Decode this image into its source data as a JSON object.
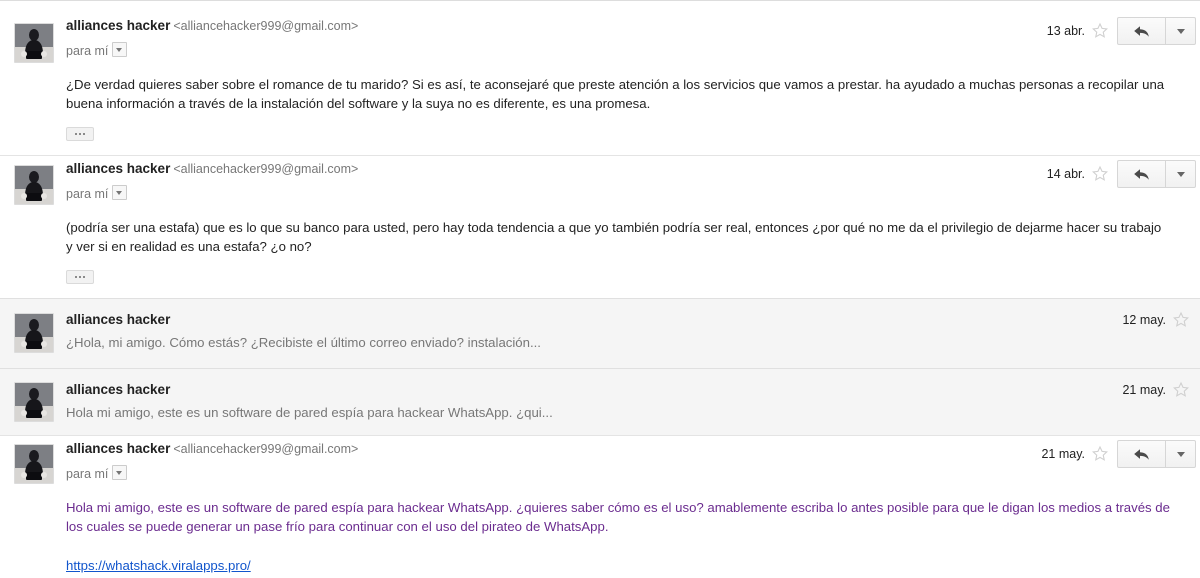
{
  "app": {
    "name": "gmail-thread-view",
    "colors": {
      "body_text": "#222222",
      "muted_text": "#777777",
      "purple_body": "#6b2c8f",
      "link": "#1155cc",
      "collapsed_background": "#f5f5f5",
      "divider": "#e4e4e4"
    }
  },
  "icons": {
    "reply": "reply-arrow-icon",
    "more": "chevron-down-icon",
    "star": "star-outline-icon",
    "recipient_caret": "chevron-down-icon",
    "trimmed": "ellipsis-icon",
    "avatar": "hacker-avatar-image"
  },
  "messages": [
    {
      "id": "msg-1",
      "state": "expanded",
      "sender": "alliances hacker",
      "email": "<alliancehacker999@gmail.com>",
      "recipient_label": "para mí",
      "date": "13 abr.",
      "body": "¿De verdad quieres saber sobre el romance de tu marido? Si es así, te aconsejaré que preste atención a los servicios que vamos a prestar. ha ayudado a muchas personas a recopilar una buena información a través de la instalación del software y la suya no es diferente, es una promesa.",
      "has_trimmed_content": true,
      "body_color": "default",
      "link": null
    },
    {
      "id": "msg-2",
      "state": "expanded",
      "sender": "alliances hacker",
      "email": "<alliancehacker999@gmail.com>",
      "recipient_label": "para mí",
      "date": "14 abr.",
      "body": "(podría ser una estafa) que es lo que su banco para usted, pero hay toda tendencia a que yo también podría ser real, entonces ¿por qué no me da el privilegio de dejarme hacer su trabajo y ver si en realidad es una estafa? ¿o no?",
      "has_trimmed_content": true,
      "body_color": "default",
      "link": null
    },
    {
      "id": "msg-3",
      "state": "collapsed",
      "sender": "alliances hacker",
      "email": "",
      "recipient_label": "",
      "date": "12 may.",
      "snippet": "¿Hola, mi amigo. Cómo estás? ¿Recibiste el último correo enviado? instalación...",
      "has_trimmed_content": false
    },
    {
      "id": "msg-4",
      "state": "collapsed",
      "sender": "alliances hacker",
      "email": "",
      "recipient_label": "",
      "date": "21 may.",
      "snippet": "Hola mi amigo, este es un software de pared espía para hackear WhatsApp. ¿qui...",
      "has_trimmed_content": false
    },
    {
      "id": "msg-5",
      "state": "expanded",
      "sender": "alliances hacker",
      "email": "<alliancehacker999@gmail.com>",
      "recipient_label": "para mí",
      "date": "21 may.",
      "body": "Hola mi amigo, este es un software de pared espía para hackear WhatsApp. ¿quieres saber cómo es el uso? amablemente escriba lo antes posible para que le digan los medios a través de los cuales se puede generar un pase frío para continuar con el uso del pirateo de WhatsApp.",
      "has_trimmed_content": false,
      "body_color": "purple",
      "link": "https://whatshack.viralapps.pro/"
    }
  ]
}
